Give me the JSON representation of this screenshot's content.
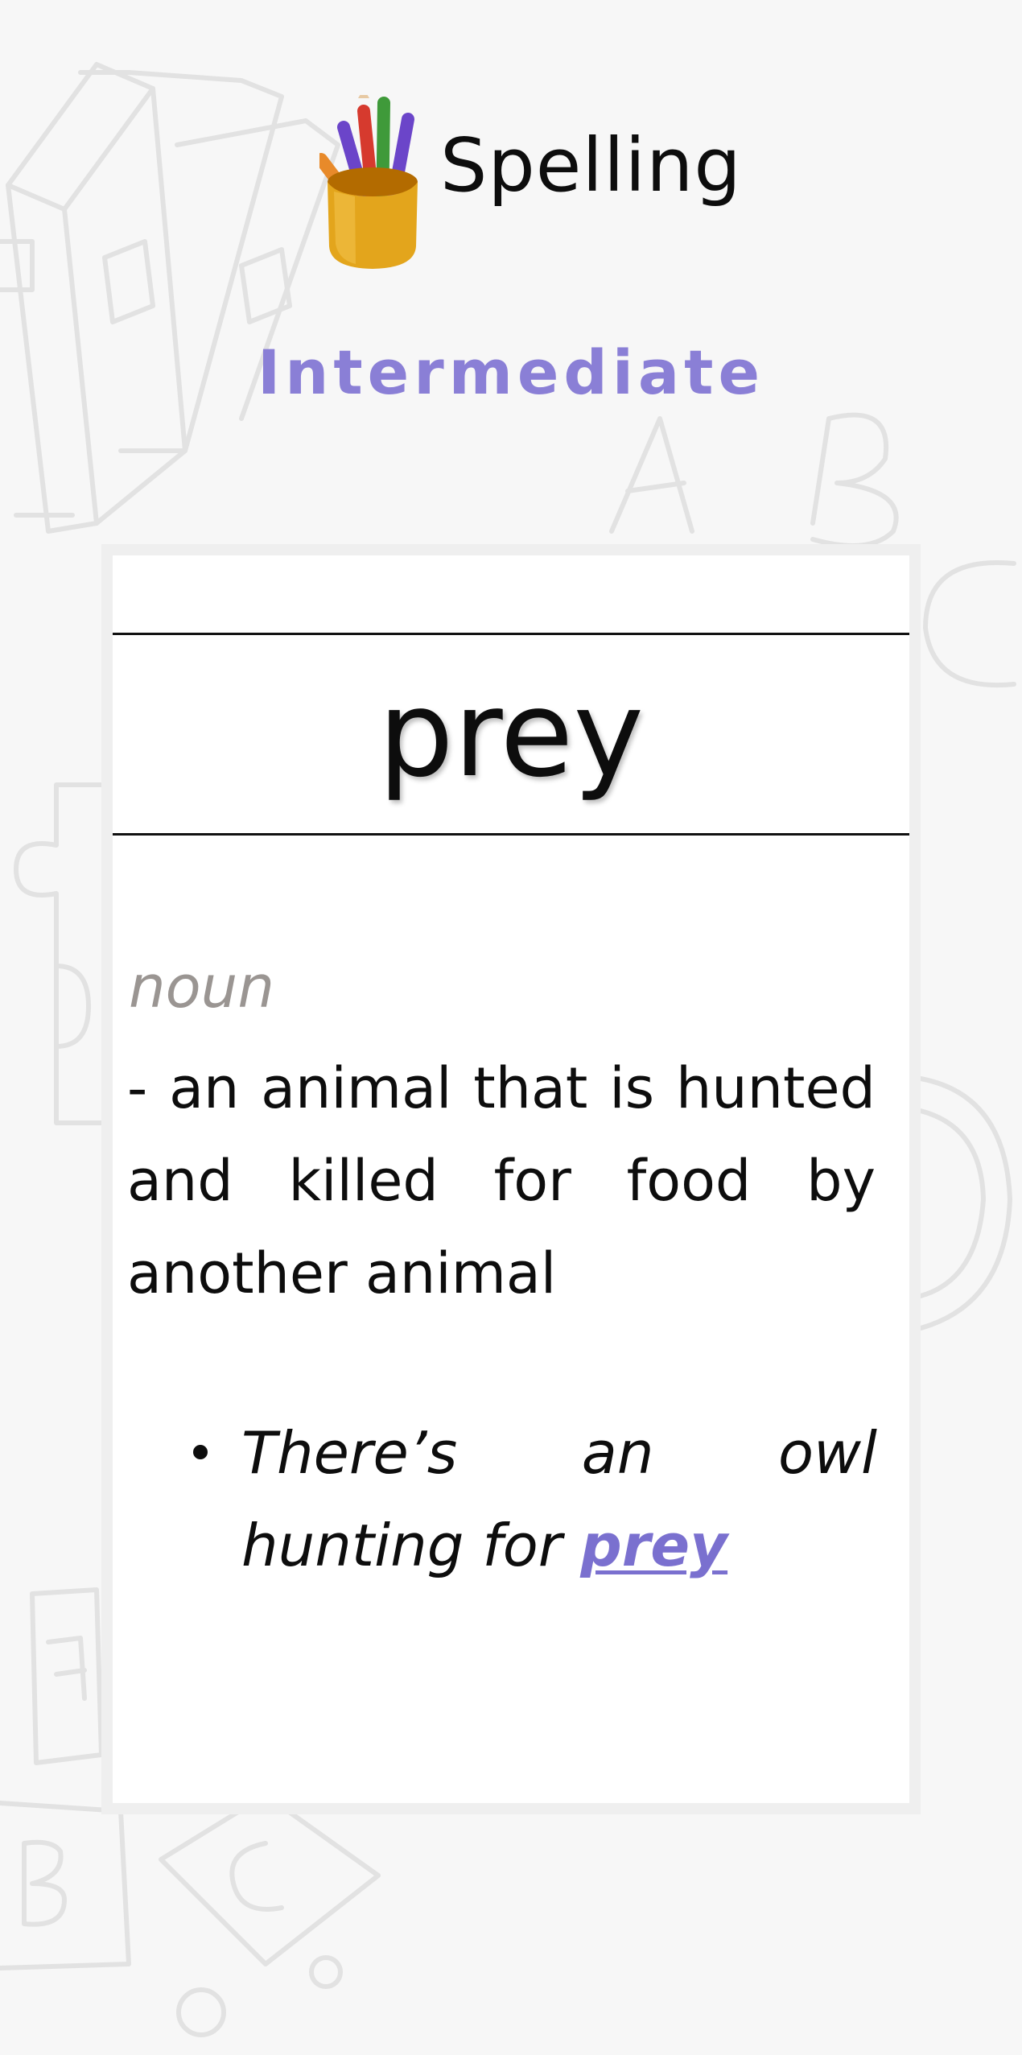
{
  "header": {
    "app_title": "Spelling",
    "level": "Intermediate",
    "logo_icon": "pencil-cup-icon"
  },
  "card": {
    "word": "prey",
    "part_of_speech": "noun",
    "definition": " - an animal that is hunted and killed for food by another animal",
    "examples": [
      {
        "before": "There’s an owl hunting for ",
        "highlight": "prey"
      }
    ]
  },
  "colors": {
    "accent": "#8a7fd6",
    "highlight": "#7a70cf",
    "muted_text": "#9a9592",
    "background": "#f7f7f7",
    "card": "#ffffff"
  }
}
